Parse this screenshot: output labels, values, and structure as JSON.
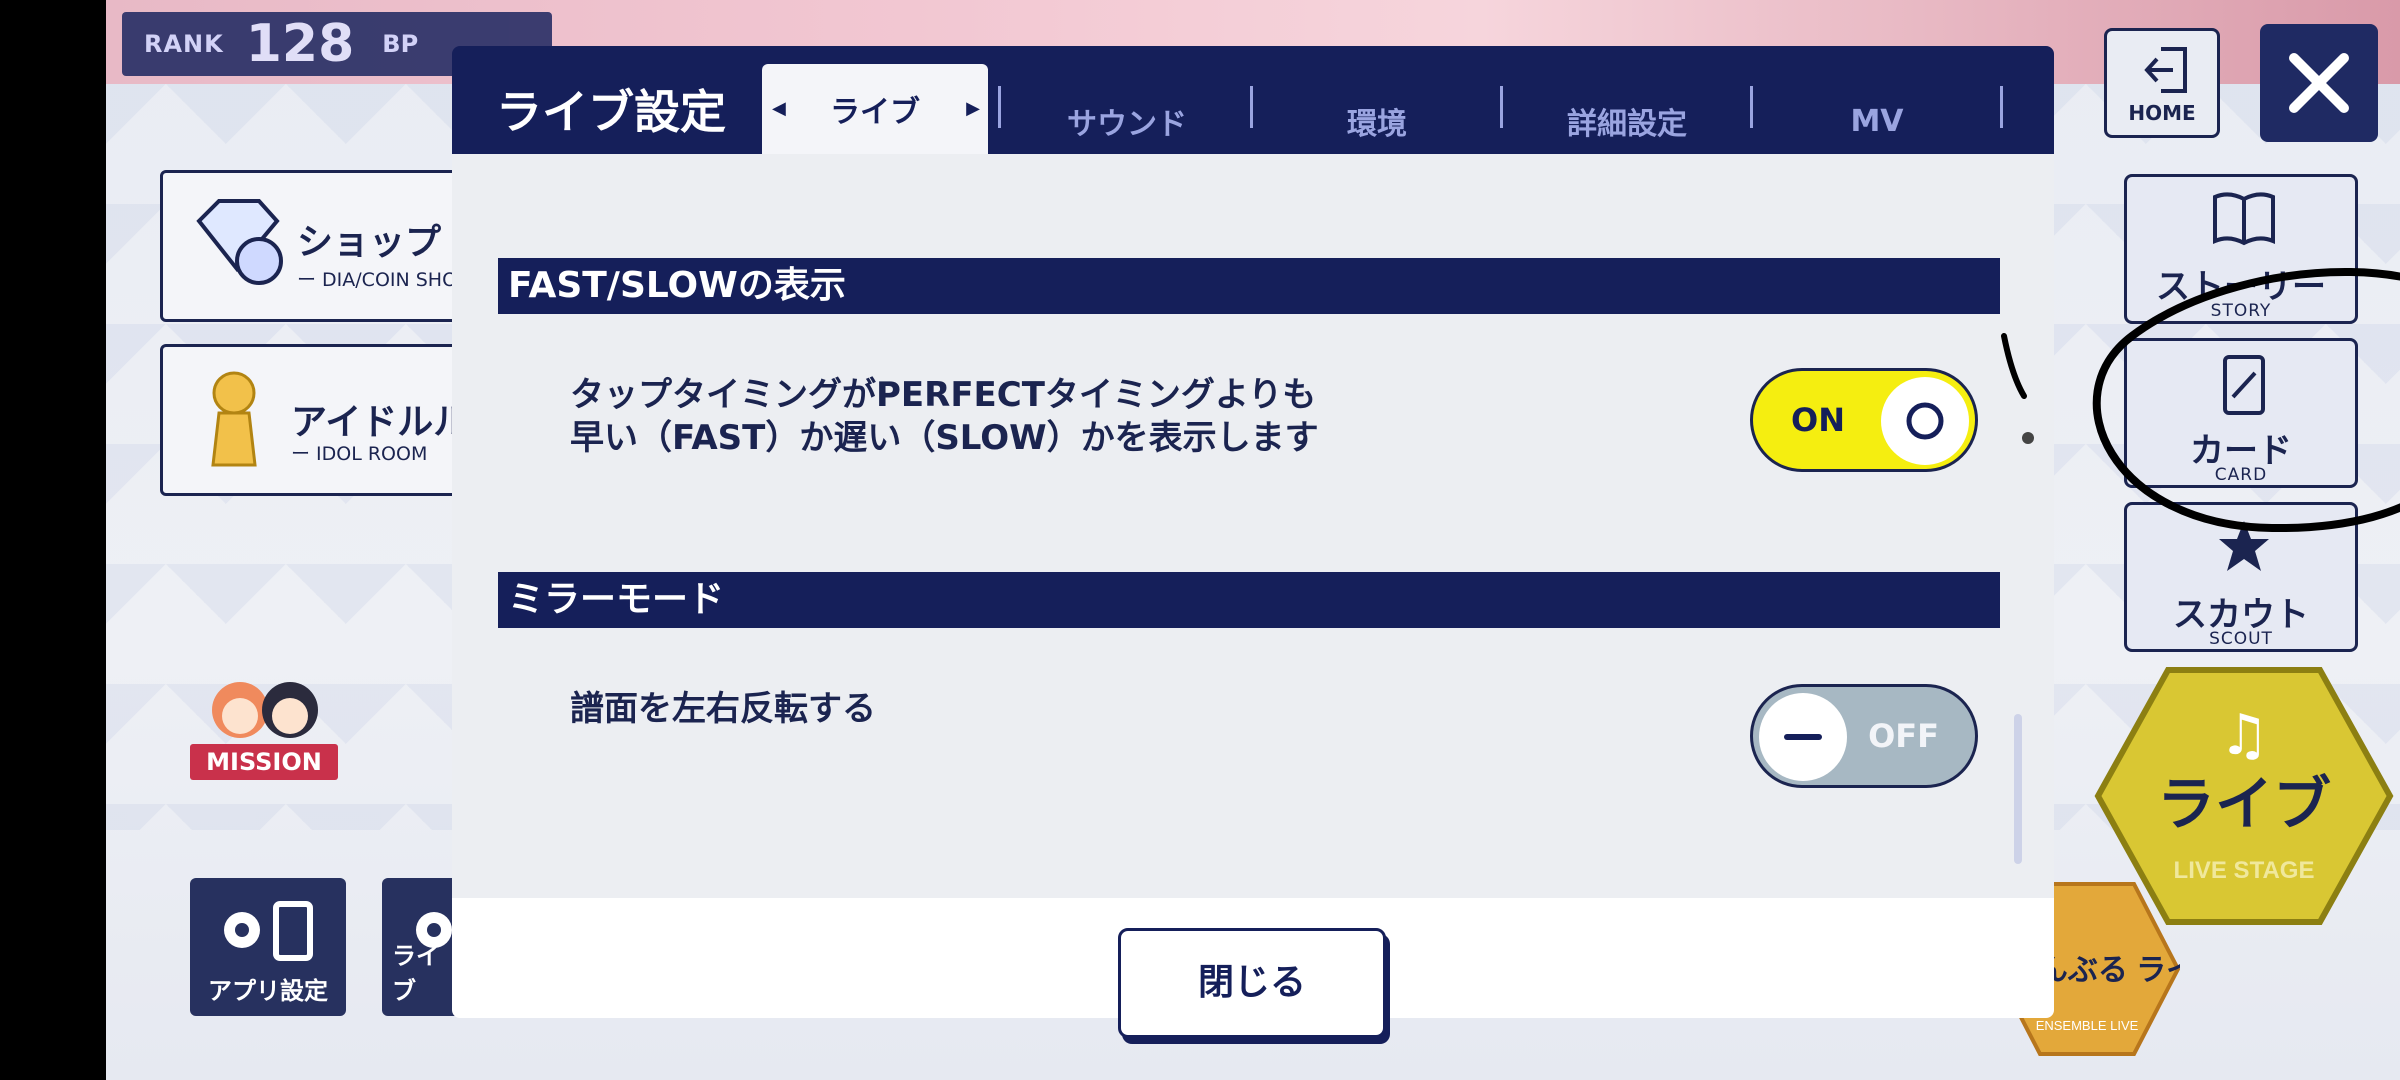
{
  "rank": {
    "label": "RANK",
    "value": "128",
    "bp_label": "BP"
  },
  "dialog": {
    "title": "ライブ設定",
    "tabs": [
      {
        "label": "ライブ",
        "active": true
      },
      {
        "label": "サウンド",
        "active": false
      },
      {
        "label": "環境",
        "active": false
      },
      {
        "label": "詳細設定",
        "active": false
      },
      {
        "label": "MV",
        "active": false
      }
    ],
    "sections": [
      {
        "header": "FAST/SLOWの表示",
        "description_line1": "タップタイミングがPERFECTタイミングよりも",
        "description_line2": "早い（FAST）か遅い（SLOW）かを表示します",
        "toggle": {
          "state_label": "ON",
          "on": true
        }
      },
      {
        "header": "ミラーモード",
        "description_line1": "譜面を左右反転する",
        "toggle": {
          "state_label": "OFF",
          "on": false
        }
      }
    ],
    "close_label": "閉じる"
  },
  "menu": {
    "shop": {
      "title": "ショップ",
      "sub": "ー DIA/COIN SHO"
    },
    "idol": {
      "title": "アイドルル",
      "sub": "ー IDOL ROOM"
    },
    "mission": "MISSION",
    "app_settings": "アプリ設定",
    "live_settings": "ライブ"
  },
  "nav": {
    "home": "HOME",
    "story": {
      "jp": "ストーリー",
      "en": "STORY"
    },
    "card": {
      "jp": "カード",
      "en": "CARD"
    },
    "scout": {
      "jp": "スカウト",
      "en": "SCOUT"
    },
    "live": {
      "jp": "ライブ",
      "en": "LIVE STAGE"
    },
    "ensemble": {
      "jp": "あんさんぶる ライブ",
      "en": "ENSEMBLE LIVE"
    }
  },
  "colors": {
    "navy": "#151f5a",
    "toggle_on": "#f5ee10",
    "toggle_off": "#a7b8c3",
    "live_gold": "#d9c733"
  }
}
